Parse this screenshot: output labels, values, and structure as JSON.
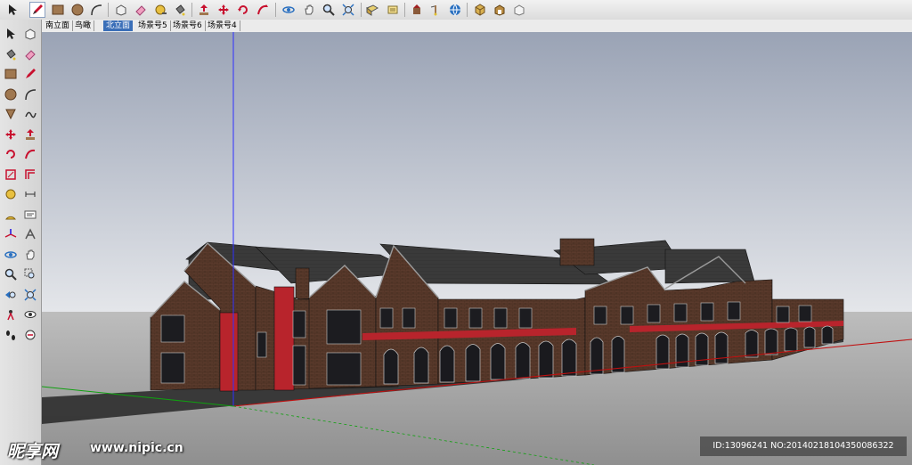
{
  "toolbar": {
    "tools": [
      "select-icon",
      "pencil-icon",
      "rectangle-icon",
      "circle-icon",
      "arc-icon",
      "make-component-icon",
      "eraser-icon",
      "tape-measure-icon",
      "paint-bucket-icon",
      "push-pull-icon",
      "move-icon",
      "rotate-icon",
      "follow-me-icon",
      "orbit-icon",
      "pan-icon",
      "zoom-icon",
      "zoom-extents-icon",
      "top-view-icon",
      "section-plane-icon",
      "position-camera-icon",
      "walk-icon",
      "get-models-icon",
      "share-model-icon",
      "warehouse-icon"
    ],
    "active_tool": "pencil-icon"
  },
  "scenes": {
    "tabs": [
      "南立面",
      "鸟瞰",
      "北立面",
      "场景号5",
      "场景号6",
      "场景号4"
    ],
    "active_index": 2
  },
  "left_toolbar": {
    "tools": [
      "select-icon",
      "component-icon",
      "paint-bucket-icon",
      "eraser-icon",
      "rectangle-icon",
      "pencil-icon",
      "circle-icon",
      "arc-icon",
      "polygon-icon",
      "freehand-icon",
      "move-icon",
      "push-pull-icon",
      "rotate-icon",
      "follow-me-icon",
      "scale-icon",
      "offset-icon",
      "tape-measure-icon",
      "dimension-icon",
      "protractor-icon",
      "text-icon",
      "axes-icon",
      "3d-text-icon",
      "orbit-icon",
      "pan-icon",
      "zoom-icon",
      "zoom-window-icon",
      "previous-view-icon",
      "zoom-extents-icon",
      "position-camera-icon",
      "look-around-icon",
      "walk-icon",
      "section-plane-icon"
    ]
  },
  "viewport": {
    "sky_top": "#9aa3b5",
    "sky_bottom": "#e4e6ea",
    "ground_top": "#bdbdbd",
    "ground_bottom": "#8f8f8f",
    "brick": "#5a3a2c",
    "roof": "#3a3a3a",
    "accent_red": "#b8242c",
    "axis_blue": "#3030ff",
    "axis_red": "#c01010",
    "axis_green": "#10a010"
  },
  "watermark": {
    "site_cn": "昵享网",
    "site_url": "www.nipic.cn"
  },
  "image_id": {
    "text": "ID:13096241 NO:20140218104350086322"
  }
}
